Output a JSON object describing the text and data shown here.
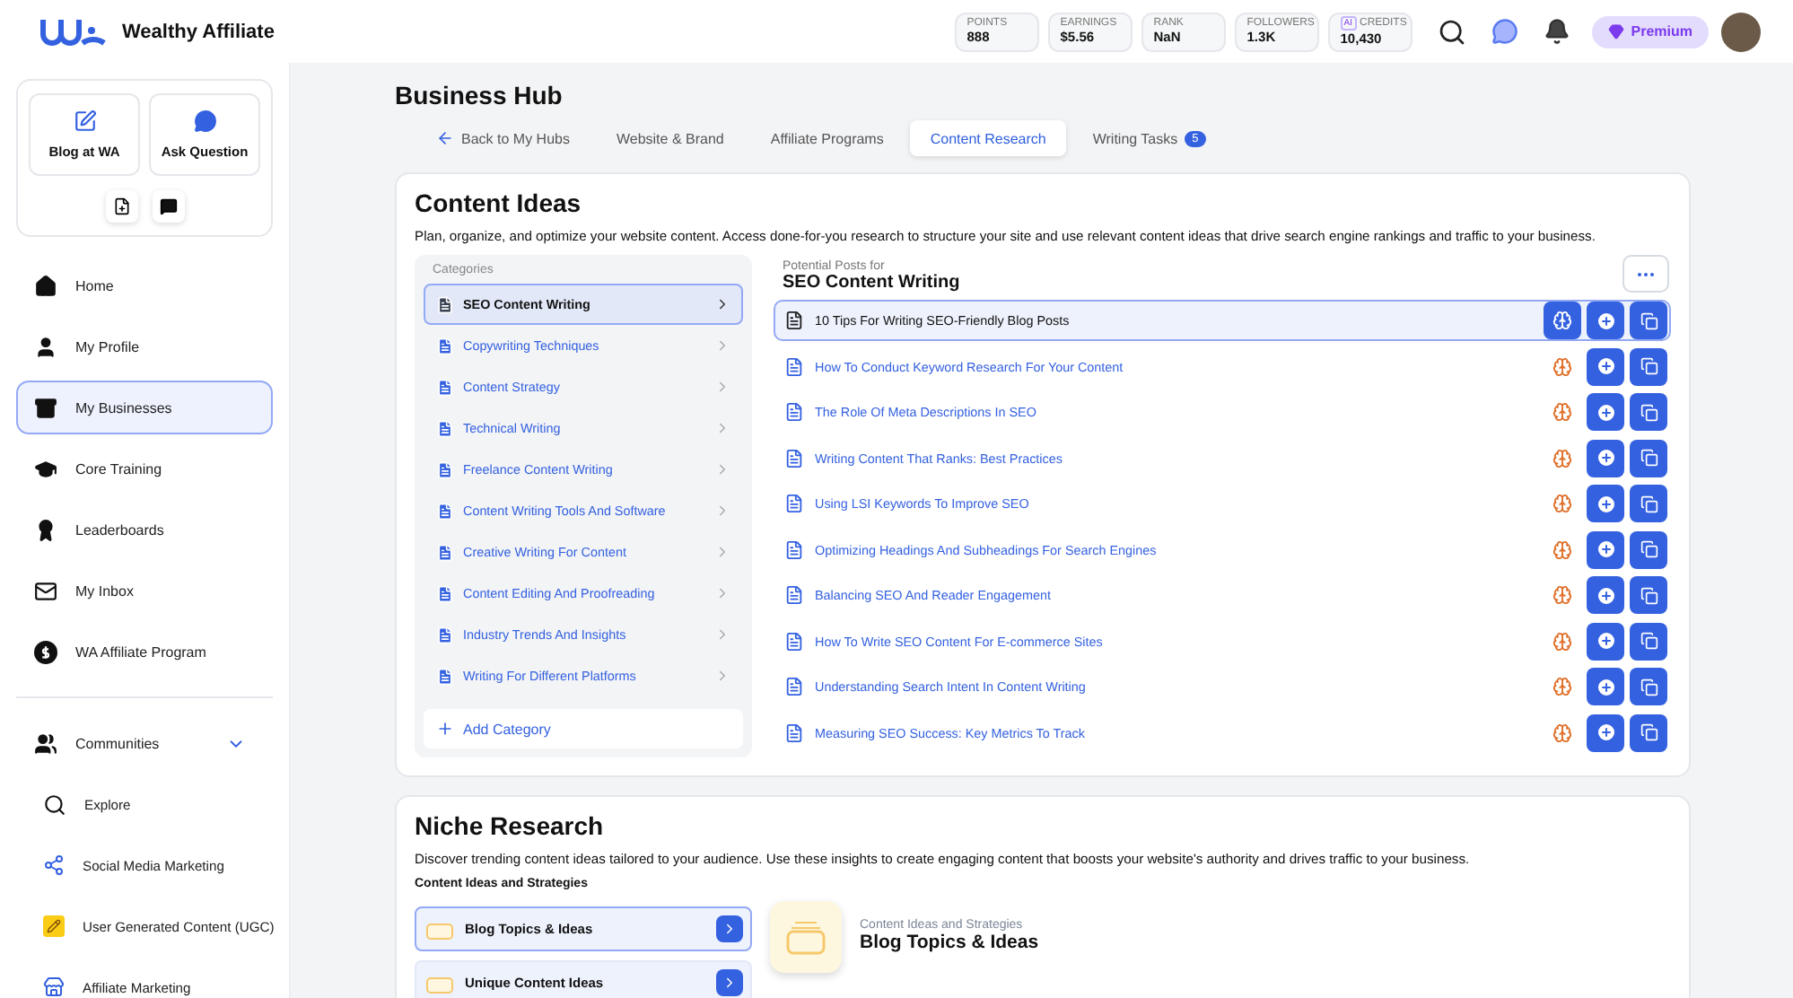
{
  "header": {
    "brand": "Wealthy Affiliate",
    "stats": [
      {
        "label": "POINTS",
        "value": "888"
      },
      {
        "label": "EARNINGS",
        "value": "$5.56"
      },
      {
        "label": "RANK",
        "value": "NaN"
      },
      {
        "label": "FOLLOWERS",
        "value": "1.3K"
      },
      {
        "label": "CREDITS",
        "value": "10,430",
        "badge": "AI"
      }
    ],
    "premium": "Premium"
  },
  "sidebar": {
    "quick_actions": [
      {
        "label": "Blog at WA",
        "kind": "blog"
      },
      {
        "label": "Ask Question",
        "kind": "ask"
      }
    ],
    "nav": [
      {
        "label": "Home",
        "kind": "home",
        "selected": false
      },
      {
        "label": "My Profile",
        "kind": "profile",
        "selected": false
      },
      {
        "label": "My Businesses",
        "kind": "business",
        "selected": true
      },
      {
        "label": "Core Training",
        "kind": "training",
        "selected": false
      },
      {
        "label": "Leaderboards",
        "kind": "leader",
        "selected": false
      },
      {
        "label": "My Inbox",
        "kind": "inbox",
        "selected": false
      },
      {
        "label": "WA Affiliate Program",
        "kind": "affiliate",
        "selected": false
      }
    ],
    "communities": {
      "label": "Communities",
      "expanded": true,
      "children": [
        {
          "label": "Explore",
          "kind": "explore"
        },
        {
          "label": "Social Media Marketing",
          "kind": "social"
        },
        {
          "label": "User Generated Content (UGC)",
          "kind": "ugc"
        },
        {
          "label": "Affiliate Marketing",
          "kind": "affmkt"
        }
      ]
    }
  },
  "main": {
    "title": "Business Hub",
    "tabs": [
      {
        "label": "Back to My Hubs",
        "kind": "back",
        "selected": false
      },
      {
        "label": "Website & Brand",
        "kind": "tab",
        "selected": false
      },
      {
        "label": "Affiliate Programs",
        "kind": "tab",
        "selected": false
      },
      {
        "label": "Content Research",
        "kind": "tab",
        "selected": true
      },
      {
        "label": "Writing Tasks",
        "kind": "tab",
        "selected": false,
        "badge": "5"
      }
    ],
    "content_ideas": {
      "title": "Content Ideas",
      "description": "Plan, organize, and optimize your website content. Access done-for-you research to structure your site and use relevant content ideas that drive search engine rankings and traffic to your business.",
      "categories_heading": "Categories",
      "categories": [
        {
          "label": "SEO Content Writing",
          "selected": true
        },
        {
          "label": "Copywriting Techniques",
          "selected": false
        },
        {
          "label": "Content Strategy",
          "selected": false
        },
        {
          "label": "Technical Writing",
          "selected": false
        },
        {
          "label": "Freelance Content Writing",
          "selected": false
        },
        {
          "label": "Content Writing Tools And Software",
          "selected": false
        },
        {
          "label": "Creative Writing For Content",
          "selected": false
        },
        {
          "label": "Content Editing And Proofreading",
          "selected": false
        },
        {
          "label": "Industry Trends And Insights",
          "selected": false
        },
        {
          "label": "Writing For Different Platforms",
          "selected": false
        }
      ],
      "add_category": "Add Category",
      "posts_heading": "Potential Posts for",
      "posts_category": "SEO Content Writing",
      "posts": [
        {
          "title": "10 Tips For Writing SEO-Friendly Blog Posts",
          "selected": true
        },
        {
          "title": "How To Conduct Keyword Research For Your Content",
          "selected": false
        },
        {
          "title": "The Role Of Meta Descriptions In SEO",
          "selected": false
        },
        {
          "title": "Writing Content That Ranks: Best Practices",
          "selected": false
        },
        {
          "title": "Using LSI Keywords To Improve SEO",
          "selected": false
        },
        {
          "title": "Optimizing Headings And Subheadings For Search Engines",
          "selected": false
        },
        {
          "title": "Balancing SEO And Reader Engagement",
          "selected": false
        },
        {
          "title": "How To Write SEO Content For E-commerce Sites",
          "selected": false
        },
        {
          "title": "Understanding Search Intent In Content Writing",
          "selected": false
        },
        {
          "title": "Measuring SEO Success: Key Metrics To Track",
          "selected": false
        }
      ]
    },
    "niche": {
      "title": "Niche Research",
      "description": "Discover trending content ideas tailored to your audience. Use these insights to create engaging content that boosts your website's authority and drives traffic to your business.",
      "list_heading": "Content Ideas and Strategies",
      "items": [
        {
          "label": "Blog Topics & Ideas",
          "selected": true
        },
        {
          "label": "Unique Content Ideas",
          "selected": false
        }
      ],
      "detail": {
        "eyebrow": "Content Ideas and Strategies",
        "title": "Blog Topics & Ideas"
      }
    }
  }
}
